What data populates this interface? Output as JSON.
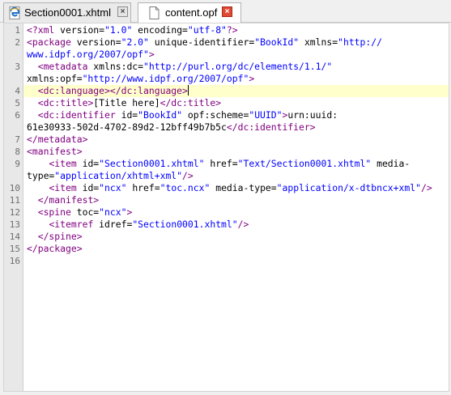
{
  "tabs": [
    {
      "label": "Section0001.xhtml",
      "icon": "ie-file-icon",
      "close": "×"
    },
    {
      "label": "content.opf",
      "icon": "document-icon",
      "close": "×"
    }
  ],
  "editor": {
    "active_line": 4,
    "rows": [
      {
        "num": "1",
        "segs": [
          [
            "t",
            "<?xml "
          ],
          [
            "a",
            "version="
          ],
          [
            "v",
            "\"1.0\""
          ],
          [
            "a",
            " encoding="
          ],
          [
            "v",
            "\"utf-8\""
          ],
          [
            "t",
            "?>"
          ]
        ]
      },
      {
        "num": "2",
        "segs": [
          [
            "t",
            "<package "
          ],
          [
            "a",
            "version="
          ],
          [
            "v",
            "\"2.0\""
          ],
          [
            "a",
            " unique-identifier="
          ],
          [
            "v",
            "\"BookId\""
          ],
          [
            "a",
            " xmlns="
          ],
          [
            "v",
            "\"http://"
          ]
        ]
      },
      {
        "num": "",
        "segs": [
          [
            "v",
            "www.idpf.org/2007/opf\""
          ],
          [
            "t",
            ">"
          ]
        ]
      },
      {
        "num": "3",
        "segs": [
          [
            "p",
            "  "
          ],
          [
            "t",
            "<metadata "
          ],
          [
            "a",
            "xmlns:dc="
          ],
          [
            "v",
            "\"http://purl.org/dc/elements/1.1/\""
          ]
        ]
      },
      {
        "num": "",
        "segs": [
          [
            "a",
            "xmlns:opf="
          ],
          [
            "v",
            "\"http://www.idpf.org/2007/opf\""
          ],
          [
            "t",
            ">"
          ]
        ]
      },
      {
        "num": "4",
        "segs": [
          [
            "p",
            "  "
          ],
          [
            "t",
            "<dc:language></dc:language>"
          ],
          [
            "caret",
            ""
          ]
        ]
      },
      {
        "num": "5",
        "segs": [
          [
            "p",
            "  "
          ],
          [
            "t",
            "<dc:title>"
          ],
          [
            "p",
            "[Title here]"
          ],
          [
            "t",
            "</dc:title>"
          ]
        ]
      },
      {
        "num": "6",
        "segs": [
          [
            "p",
            "  "
          ],
          [
            "t",
            "<dc:identifier "
          ],
          [
            "a",
            "id="
          ],
          [
            "v",
            "\"BookId\""
          ],
          [
            "a",
            " opf:scheme="
          ],
          [
            "v",
            "\"UUID\""
          ],
          [
            "t",
            ">"
          ],
          [
            "p",
            "urn:uuid:"
          ]
        ]
      },
      {
        "num": "",
        "segs": [
          [
            "p",
            "61e30933-502d-4702-89d2-12bff49b7b5c"
          ],
          [
            "t",
            "</dc:identifier>"
          ]
        ]
      },
      {
        "num": "7",
        "segs": [
          [
            "t",
            "</metadata>"
          ]
        ]
      },
      {
        "num": "8",
        "segs": [
          [
            "t",
            "<manifest>"
          ]
        ]
      },
      {
        "num": "9",
        "segs": [
          [
            "p",
            "    "
          ],
          [
            "t",
            "<item "
          ],
          [
            "a",
            "id="
          ],
          [
            "v",
            "\"Section0001.xhtml\""
          ],
          [
            "a",
            " href="
          ],
          [
            "v",
            "\"Text/Section0001.xhtml\""
          ],
          [
            "a",
            " media-"
          ]
        ]
      },
      {
        "num": "",
        "segs": [
          [
            "a",
            "type="
          ],
          [
            "v",
            "\"application/xhtml+xml\""
          ],
          [
            "t",
            "/>"
          ]
        ]
      },
      {
        "num": "10",
        "segs": [
          [
            "p",
            "    "
          ],
          [
            "t",
            "<item "
          ],
          [
            "a",
            "id="
          ],
          [
            "v",
            "\"ncx\""
          ],
          [
            "a",
            " href="
          ],
          [
            "v",
            "\"toc.ncx\""
          ],
          [
            "a",
            " media-type="
          ],
          [
            "v",
            "\"application/x-dtbncx+xml\""
          ],
          [
            "t",
            "/>"
          ]
        ]
      },
      {
        "num": "11",
        "segs": [
          [
            "p",
            "  "
          ],
          [
            "t",
            "</manifest>"
          ]
        ]
      },
      {
        "num": "12",
        "segs": [
          [
            "p",
            "  "
          ],
          [
            "t",
            "<spine "
          ],
          [
            "a",
            "toc="
          ],
          [
            "v",
            "\"ncx\""
          ],
          [
            "t",
            ">"
          ]
        ]
      },
      {
        "num": "13",
        "segs": [
          [
            "p",
            "    "
          ],
          [
            "t",
            "<itemref "
          ],
          [
            "a",
            "idref="
          ],
          [
            "v",
            "\"Section0001.xhtml\""
          ],
          [
            "t",
            "/>"
          ]
        ]
      },
      {
        "num": "14",
        "segs": [
          [
            "p",
            "  "
          ],
          [
            "t",
            "</spine>"
          ]
        ]
      },
      {
        "num": "15",
        "segs": [
          [
            "t",
            "</package>"
          ]
        ]
      },
      {
        "num": "16",
        "segs": []
      }
    ]
  }
}
